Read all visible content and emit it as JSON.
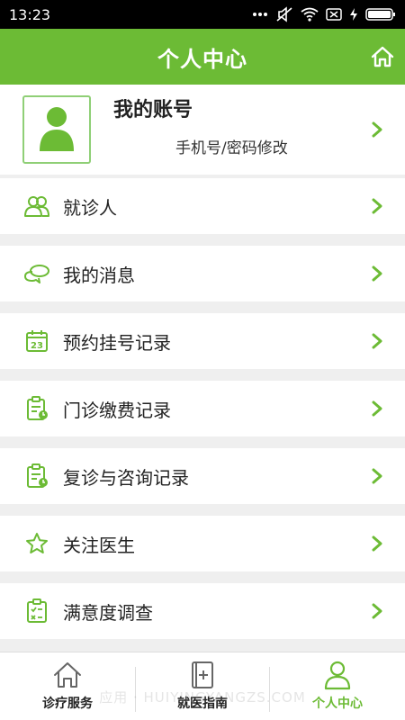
{
  "status_bar": {
    "time": "13:23"
  },
  "header": {
    "title": "个人中心",
    "home_icon": "home-icon"
  },
  "account": {
    "title": "我的账号",
    "subtitle": "手机号/密码修改"
  },
  "menu": [
    {
      "label": "就诊人",
      "icon": "patients-icon"
    },
    {
      "label": "我的消息",
      "icon": "messages-icon"
    },
    {
      "label": "预约挂号记录",
      "icon": "calendar-icon",
      "icon_text": "23"
    },
    {
      "label": "门诊缴费记录",
      "icon": "payment-record-icon"
    },
    {
      "label": "复诊与咨询记录",
      "icon": "consult-record-icon"
    },
    {
      "label": "关注医生",
      "icon": "star-icon"
    },
    {
      "label": "满意度调查",
      "icon": "survey-icon"
    }
  ],
  "tabs": [
    {
      "label": "诊疗服务",
      "icon": "home-icon"
    },
    {
      "label": "就医指南",
      "icon": "guide-book-icon"
    },
    {
      "label": "个人中心",
      "icon": "person-icon"
    }
  ],
  "watermark": "应用 · HUIYINGYANGZS.COM",
  "colors": {
    "accent": "#6cbb35",
    "background": "#efefef"
  }
}
